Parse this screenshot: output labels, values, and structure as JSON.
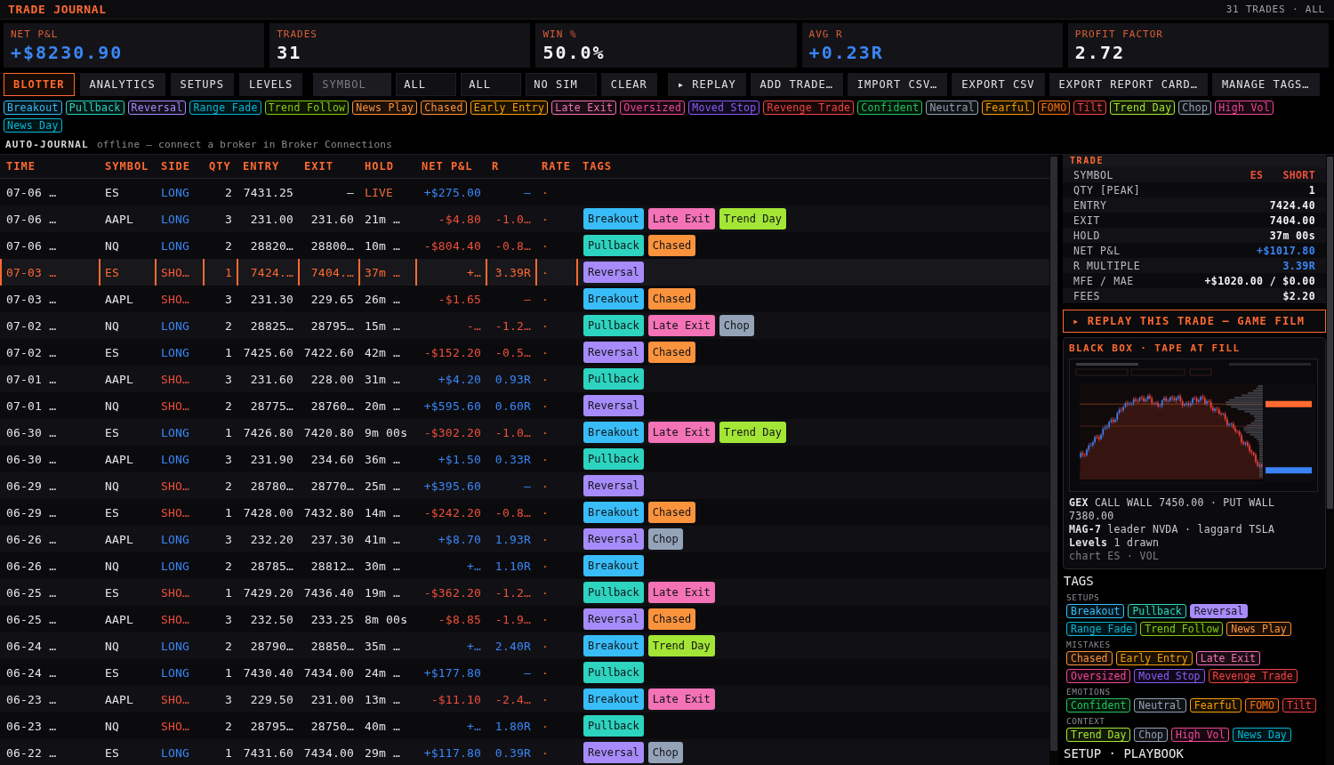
{
  "header": {
    "title": "TRADE JOURNAL",
    "summary": "31 TRADES · ALL"
  },
  "stats": [
    {
      "label": "NET P&L",
      "value": "+$8230.90",
      "positive": true
    },
    {
      "label": "TRADES",
      "value": "31",
      "positive": false
    },
    {
      "label": "WIN %",
      "value": "50.0%",
      "positive": false
    },
    {
      "label": "AVG R",
      "value": "+0.23R",
      "positive": true
    },
    {
      "label": "PROFIT FACTOR",
      "value": "2.72",
      "positive": false
    }
  ],
  "tabs": [
    {
      "label": "BLOTTER",
      "selected": true
    },
    {
      "label": "ANALYTICS",
      "selected": false
    },
    {
      "label": "SETUPS",
      "selected": false
    },
    {
      "label": "LEVELS",
      "selected": false
    }
  ],
  "filters": {
    "symbol": {
      "placeholder": "SYMBOL"
    },
    "selects": [
      {
        "value": "ALL"
      },
      {
        "value": "ALL"
      },
      {
        "value": "NO SIM"
      }
    ],
    "clear_button": "CLEAR"
  },
  "actions": [
    "▸ REPLAY",
    "ADD TRADE…",
    "IMPORT CSV…",
    "EXPORT CSV",
    "EXPORT REPORT CARD…",
    "MANAGE TAGS…"
  ],
  "tag_filters": [
    {
      "label": "Breakout",
      "color": "#38bdf8",
      "selected": false
    },
    {
      "label": "Pullback",
      "color": "#2dd4bf",
      "selected": false
    },
    {
      "label": "Reversal",
      "color": "#a78bfa",
      "selected": false
    },
    {
      "label": "Range Fade",
      "color": "#06b6d4",
      "selected": false
    },
    {
      "label": "Trend Follow",
      "color": "#84cc16",
      "selected": false
    },
    {
      "label": "News Play",
      "color": "#fb923c",
      "selected": false
    },
    {
      "label": "Chased",
      "color": "#fb923c",
      "selected": false
    },
    {
      "label": "Early Entry",
      "color": "#f59e0b",
      "selected": false
    },
    {
      "label": "Late Exit",
      "color": "#f472b6",
      "selected": false
    },
    {
      "label": "Oversized",
      "color": "#ec4899",
      "selected": false
    },
    {
      "label": "Moved Stop",
      "color": "#8b5cf6",
      "selected": false
    },
    {
      "label": "Revenge Trade",
      "color": "#ef4444",
      "selected": false
    },
    {
      "label": "Confident",
      "color": "#22c55e",
      "selected": false
    },
    {
      "label": "Neutral",
      "color": "#94a3b8",
      "selected": false
    },
    {
      "label": "Fearful",
      "color": "#f59e0b",
      "selected": false
    },
    {
      "label": "FOMO",
      "color": "#f97316",
      "selected": false
    },
    {
      "label": "Tilt",
      "color": "#ef4444",
      "selected": false
    },
    {
      "label": "Trend Day",
      "color": "#a3e635",
      "selected": false
    },
    {
      "label": "Chop",
      "color": "#94a3b8",
      "selected": false
    },
    {
      "label": "High Vol",
      "color": "#ec4899",
      "selected": false
    },
    {
      "label": "News Day",
      "color": "#06b6d4",
      "selected": false
    }
  ],
  "auto_journal": {
    "label": "AUTO-JOURNAL",
    "message": "offline — connect a broker in Broker Connections"
  },
  "table": {
    "columns": [
      "TIME",
      "SYMBOL",
      "SIDE",
      "QTY",
      "ENTRY",
      "EXIT",
      "HOLD",
      "NET P&L",
      "R",
      "RATE",
      "TAGS"
    ],
    "rows": [
      {
        "time": "07-06 …",
        "symbol": "ES",
        "side": "LONG",
        "short": false,
        "qty": "2",
        "entry": "7431.25",
        "exit": "—",
        "hold": "LIVE",
        "live": true,
        "pnl": "+$275.00",
        "r": "—",
        "loss": false,
        "rate": "·",
        "selected": false
      },
      {
        "time": "07-06 …",
        "symbol": "AAPL",
        "side": "LONG",
        "short": false,
        "qty": "3",
        "entry": "231.00",
        "exit": "231.60",
        "hold": "21m …",
        "live": false,
        "pnl": "-$4.80",
        "r": "-1.0…",
        "loss": true,
        "rate": "·",
        "selected": false,
        "tags": [
          {
            "label": "Breakout",
            "color": "#38bdf8"
          },
          {
            "label": "Late Exit",
            "color": "#f472b6"
          },
          {
            "label": "Trend Day",
            "color": "#a3e635"
          }
        ]
      },
      {
        "time": "07-06 …",
        "symbol": "NQ",
        "side": "LONG",
        "short": false,
        "qty": "2",
        "entry": "28820…",
        "exit": "28800…",
        "hold": "10m …",
        "live": false,
        "pnl": "-$804.40",
        "r": "-0.8…",
        "loss": true,
        "rate": "·",
        "selected": false,
        "tags": [
          {
            "label": "Pullback",
            "color": "#2dd4bf"
          },
          {
            "label": "Chased",
            "color": "#fb923c"
          }
        ]
      },
      {
        "time": "07-03 …",
        "symbol": "ES",
        "side": "SHO…",
        "short": true,
        "qty": "1",
        "entry": "7424.…",
        "exit": "7404.…",
        "hold": "37m …",
        "live": false,
        "pnl": "+…",
        "r": "3.39R",
        "loss": false,
        "rate": "·",
        "selected": true,
        "tags": [
          {
            "label": "Reversal",
            "color": "#a78bfa"
          }
        ]
      },
      {
        "time": "07-03 …",
        "symbol": "AAPL",
        "side": "SHO…",
        "short": true,
        "qty": "3",
        "entry": "231.30",
        "exit": "229.65",
        "hold": "26m …",
        "live": false,
        "pnl": "-$1.65",
        "r": "—",
        "loss": true,
        "rate": "·",
        "selected": false,
        "tags": [
          {
            "label": "Breakout",
            "color": "#38bdf8"
          },
          {
            "label": "Chased",
            "color": "#fb923c"
          }
        ]
      },
      {
        "time": "07-02 …",
        "symbol": "NQ",
        "side": "LONG",
        "short": false,
        "qty": "2",
        "entry": "28825…",
        "exit": "28795…",
        "hold": "15m …",
        "live": false,
        "pnl": "-…",
        "r": "-1.2…",
        "loss": true,
        "rate": "·",
        "selected": false,
        "tags": [
          {
            "label": "Pullback",
            "color": "#2dd4bf"
          },
          {
            "label": "Late Exit",
            "color": "#f472b6"
          },
          {
            "label": "Chop",
            "color": "#94a3b8"
          }
        ]
      },
      {
        "time": "07-02 …",
        "symbol": "ES",
        "side": "LONG",
        "short": false,
        "qty": "1",
        "entry": "7425.60",
        "exit": "7422.60",
        "hold": "42m …",
        "live": false,
        "pnl": "-$152.20",
        "r": "-0.5…",
        "loss": true,
        "rate": "·",
        "selected": false,
        "tags": [
          {
            "label": "Reversal",
            "color": "#a78bfa"
          },
          {
            "label": "Chased",
            "color": "#fb923c"
          }
        ]
      },
      {
        "time": "07-01 …",
        "symbol": "AAPL",
        "side": "SHO…",
        "short": true,
        "qty": "3",
        "entry": "231.60",
        "exit": "228.00",
        "hold": "31m …",
        "live": false,
        "pnl": "+$4.20",
        "r": "0.93R",
        "loss": false,
        "rate": "·",
        "selected": false,
        "tags": [
          {
            "label": "Pullback",
            "color": "#2dd4bf"
          }
        ]
      },
      {
        "time": "07-01 …",
        "symbol": "NQ",
        "side": "SHO…",
        "short": true,
        "qty": "2",
        "entry": "28775…",
        "exit": "28760…",
        "hold": "20m …",
        "live": false,
        "pnl": "+$595.60",
        "r": "0.60R",
        "loss": false,
        "rate": "·",
        "selected": false,
        "tags": [
          {
            "label": "Reversal",
            "color": "#a78bfa"
          }
        ]
      },
      {
        "time": "06-30 …",
        "symbol": "ES",
        "side": "LONG",
        "short": false,
        "qty": "1",
        "entry": "7426.80",
        "exit": "7420.80",
        "hold": "9m 00s",
        "live": false,
        "pnl": "-$302.20",
        "r": "-1.0…",
        "loss": true,
        "rate": "·",
        "selected": false,
        "tags": [
          {
            "label": "Breakout",
            "color": "#38bdf8"
          },
          {
            "label": "Late Exit",
            "color": "#f472b6"
          },
          {
            "label": "Trend Day",
            "color": "#a3e635"
          }
        ]
      },
      {
        "time": "06-30 …",
        "symbol": "AAPL",
        "side": "LONG",
        "short": false,
        "qty": "3",
        "entry": "231.90",
        "exit": "234.60",
        "hold": "36m …",
        "live": false,
        "pnl": "+$1.50",
        "r": "0.33R",
        "loss": false,
        "rate": "·",
        "selected": false,
        "tags": [
          {
            "label": "Pullback",
            "color": "#2dd4bf"
          }
        ]
      },
      {
        "time": "06-29 …",
        "symbol": "NQ",
        "side": "SHO…",
        "short": true,
        "qty": "2",
        "entry": "28780…",
        "exit": "28770…",
        "hold": "25m …",
        "live": false,
        "pnl": "+$395.60",
        "r": "—",
        "loss": false,
        "rate": "·",
        "selected": false,
        "tags": [
          {
            "label": "Reversal",
            "color": "#a78bfa"
          }
        ]
      },
      {
        "time": "06-29 …",
        "symbol": "ES",
        "side": "SHO…",
        "short": true,
        "qty": "1",
        "entry": "7428.00",
        "exit": "7432.80",
        "hold": "14m …",
        "live": false,
        "pnl": "-$242.20",
        "r": "-0.8…",
        "loss": true,
        "rate": "·",
        "selected": false,
        "tags": [
          {
            "label": "Breakout",
            "color": "#38bdf8"
          },
          {
            "label": "Chased",
            "color": "#fb923c"
          }
        ]
      },
      {
        "time": "06-26 …",
        "symbol": "AAPL",
        "side": "LONG",
        "short": false,
        "qty": "3",
        "entry": "232.20",
        "exit": "237.30",
        "hold": "41m …",
        "live": false,
        "pnl": "+$8.70",
        "r": "1.93R",
        "loss": false,
        "rate": "·",
        "selected": false,
        "tags": [
          {
            "label": "Reversal",
            "color": "#a78bfa"
          },
          {
            "label": "Chop",
            "color": "#94a3b8"
          }
        ]
      },
      {
        "time": "06-26 …",
        "symbol": "NQ",
        "side": "LONG",
        "short": false,
        "qty": "2",
        "entry": "28785…",
        "exit": "28812…",
        "hold": "30m …",
        "live": false,
        "pnl": "+…",
        "r": "1.10R",
        "loss": false,
        "rate": "·",
        "selected": false,
        "tags": [
          {
            "label": "Breakout",
            "color": "#38bdf8"
          }
        ]
      },
      {
        "time": "06-25 …",
        "symbol": "ES",
        "side": "SHO…",
        "short": true,
        "qty": "1",
        "entry": "7429.20",
        "exit": "7436.40",
        "hold": "19m …",
        "live": false,
        "pnl": "-$362.20",
        "r": "-1.2…",
        "loss": true,
        "rate": "·",
        "selected": false,
        "tags": [
          {
            "label": "Pullback",
            "color": "#2dd4bf"
          },
          {
            "label": "Late Exit",
            "color": "#f472b6"
          }
        ]
      },
      {
        "time": "06-25 …",
        "symbol": "AAPL",
        "side": "SHO…",
        "short": true,
        "qty": "3",
        "entry": "232.50",
        "exit": "233.25",
        "hold": "8m 00s",
        "live": false,
        "pnl": "-$8.85",
        "r": "-1.9…",
        "loss": true,
        "rate": "·",
        "selected": false,
        "tags": [
          {
            "label": "Reversal",
            "color": "#a78bfa"
          },
          {
            "label": "Chased",
            "color": "#fb923c"
          }
        ]
      },
      {
        "time": "06-24 …",
        "symbol": "NQ",
        "side": "LONG",
        "short": false,
        "qty": "2",
        "entry": "28790…",
        "exit": "28850…",
        "hold": "35m …",
        "live": false,
        "pnl": "+…",
        "r": "2.40R",
        "loss": false,
        "rate": "·",
        "selected": false,
        "tags": [
          {
            "label": "Breakout",
            "color": "#38bdf8"
          },
          {
            "label": "Trend Day",
            "color": "#a3e635"
          }
        ]
      },
      {
        "time": "06-24 …",
        "symbol": "ES",
        "side": "LONG",
        "short": false,
        "qty": "1",
        "entry": "7430.40",
        "exit": "7434.00",
        "hold": "24m …",
        "live": false,
        "pnl": "+$177.80",
        "r": "—",
        "loss": false,
        "rate": "·",
        "selected": false,
        "tags": [
          {
            "label": "Pullback",
            "color": "#2dd4bf"
          }
        ]
      },
      {
        "time": "06-23 …",
        "symbol": "AAPL",
        "side": "SHO…",
        "short": true,
        "qty": "3",
        "entry": "229.50",
        "exit": "231.00",
        "hold": "13m …",
        "live": false,
        "pnl": "-$11.10",
        "r": "-2.4…",
        "loss": true,
        "rate": "·",
        "selected": false,
        "tags": [
          {
            "label": "Breakout",
            "color": "#38bdf8"
          },
          {
            "label": "Late Exit",
            "color": "#f472b6"
          }
        ]
      },
      {
        "time": "06-23 …",
        "symbol": "NQ",
        "side": "SHO…",
        "short": true,
        "qty": "2",
        "entry": "28795…",
        "exit": "28750…",
        "hold": "40m …",
        "live": false,
        "pnl": "+…",
        "r": "1.80R",
        "loss": false,
        "rate": "·",
        "selected": false,
        "tags": [
          {
            "label": "Pullback",
            "color": "#2dd4bf"
          }
        ]
      },
      {
        "time": "06-22 …",
        "symbol": "ES",
        "side": "LONG",
        "short": false,
        "qty": "1",
        "entry": "7431.60",
        "exit": "7434.00",
        "hold": "29m …",
        "live": false,
        "pnl": "+$117.80",
        "r": "0.39R",
        "loss": false,
        "rate": "·",
        "selected": false,
        "tags": [
          {
            "label": "Reversal",
            "color": "#a78bfa"
          },
          {
            "label": "Chop",
            "color": "#94a3b8"
          }
        ]
      }
    ]
  },
  "trade_panel": {
    "title": "TRADE",
    "fields": [
      {
        "label": "SYMBOL",
        "values": [
          "ES",
          "SHORT"
        ],
        "short": true,
        "positive": false
      },
      {
        "label": "QTY [PEAK]",
        "values": [
          "1"
        ],
        "short": false,
        "positive": false
      },
      {
        "label": "ENTRY",
        "values": [
          "7424.40"
        ],
        "short": false,
        "positive": false
      },
      {
        "label": "EXIT",
        "values": [
          "7404.00"
        ],
        "short": false,
        "positive": false
      },
      {
        "label": "HOLD",
        "values": [
          "37m 00s"
        ],
        "short": false,
        "positive": false
      },
      {
        "label": "NET P&L",
        "values": [
          "+$1017.80"
        ],
        "short": false,
        "positive": true
      },
      {
        "label": "R MULTIPLE",
        "values": [
          "3.39R"
        ],
        "short": false,
        "positive": true
      },
      {
        "label": "MFE / MAE",
        "values": [
          "+$1020.00 / $0.00"
        ],
        "short": false,
        "positive": false
      },
      {
        "label": "FEES",
        "values": [
          "$2.20"
        ],
        "short": false,
        "positive": false
      }
    ]
  },
  "replay_button": "▸ REPLAY THIS TRADE — GAME FILM",
  "black_box": {
    "title": "BLACK BOX · TAPE AT FILL",
    "notes": [
      "**GEX** CALL WALL 7450.00 · PUT WALL 7380.00",
      "**MAG-7** leader NVDA · laggard TSLA",
      "**Levels** 1 drawn"
    ],
    "footnote": "chart ES · VOL"
  },
  "tags_panel": {
    "title": "TAGS",
    "groups": [
      {
        "label": "SETUPS",
        "tags": [
          {
            "label": "Breakout",
            "color": "#38bdf8",
            "selected": false
          },
          {
            "label": "Pullback",
            "color": "#2dd4bf",
            "selected": false
          },
          {
            "label": "Reversal",
            "color": "#a78bfa",
            "selected": true
          },
          {
            "label": "Range Fade",
            "color": "#06b6d4",
            "selected": false
          },
          {
            "label": "Trend Follow",
            "color": "#84cc16",
            "selected": false
          },
          {
            "label": "News Play",
            "color": "#fb923c",
            "selected": false
          }
        ]
      },
      {
        "label": "MISTAKES",
        "tags": [
          {
            "label": "Chased",
            "color": "#fb923c",
            "selected": false
          },
          {
            "label": "Early Entry",
            "color": "#f59e0b",
            "selected": false
          },
          {
            "label": "Late Exit",
            "color": "#f472b6",
            "selected": false
          },
          {
            "label": "Oversized",
            "color": "#ec4899",
            "selected": false
          },
          {
            "label": "Moved Stop",
            "color": "#8b5cf6",
            "selected": false
          },
          {
            "label": "Revenge Trade",
            "color": "#ef4444",
            "selected": false
          }
        ]
      },
      {
        "label": "EMOTIONS",
        "tags": [
          {
            "label": "Confident",
            "color": "#22c55e",
            "selected": false
          },
          {
            "label": "Neutral",
            "color": "#94a3b8",
            "selected": false
          },
          {
            "label": "Fearful",
            "color": "#f59e0b",
            "selected": false
          },
          {
            "label": "FOMO",
            "color": "#f97316",
            "selected": false
          },
          {
            "label": "Tilt",
            "color": "#ef4444",
            "selected": false
          }
        ]
      },
      {
        "label": "CONTEXT",
        "tags": [
          {
            "label": "Trend Day",
            "color": "#a3e635",
            "selected": false
          },
          {
            "label": "Chop",
            "color": "#94a3b8",
            "selected": false
          },
          {
            "label": "High Vol",
            "color": "#ec4899",
            "selected": false
          },
          {
            "label": "News Day",
            "color": "#06b6d4",
            "selected": false
          }
        ]
      }
    ]
  },
  "next_section": "SETUP · PLAYBOOK"
}
